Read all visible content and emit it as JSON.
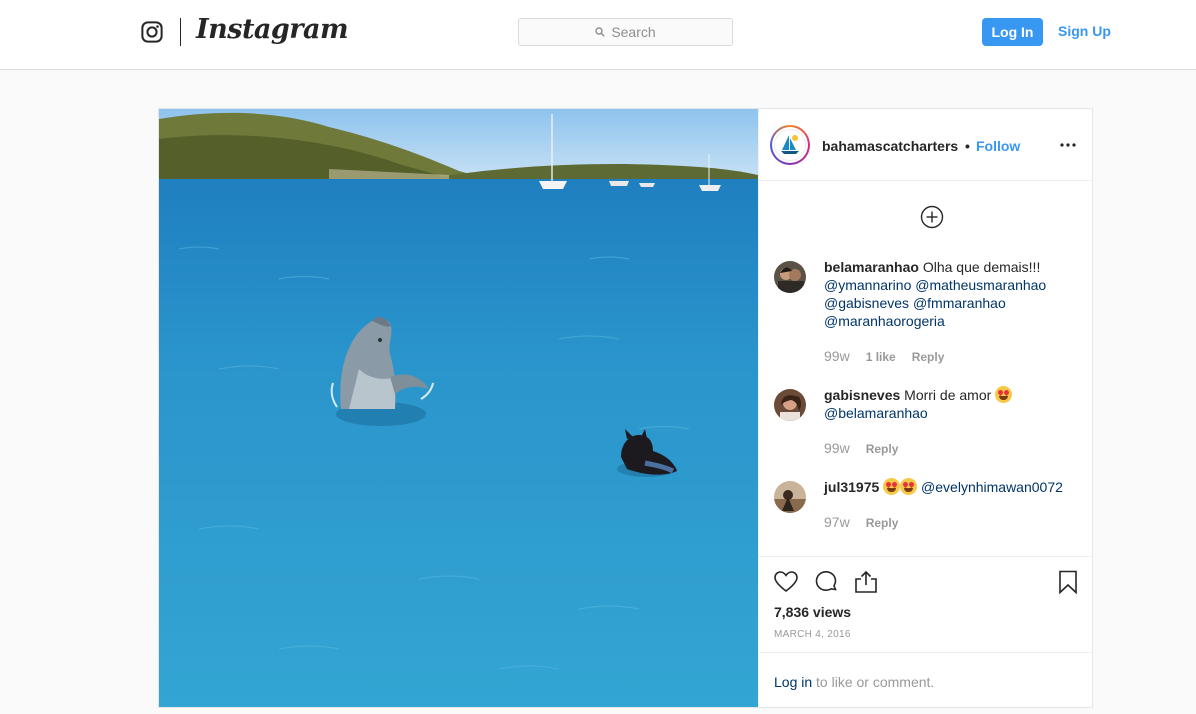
{
  "header": {
    "brand": "Instagram",
    "search_placeholder": "Search",
    "login_label": "Log In",
    "signup_label": "Sign Up"
  },
  "post": {
    "owner": "bahamascatcharters",
    "separator": "•",
    "follow_label": "Follow",
    "comments": [
      {
        "user": "belamaranhao",
        "text": "Olha que demais!!!",
        "mentions": [
          "@ymannarino",
          "@matheusmaranhao",
          "@gabisneves",
          "@fmmaranhao",
          "@maranhaorogeria"
        ],
        "time": "99w",
        "likes": "1 like",
        "reply": "Reply"
      },
      {
        "user": "gabisneves",
        "text": "Morri de amor",
        "mentions": [
          "@belamaranhao"
        ],
        "time": "99w",
        "reply": "Reply"
      },
      {
        "user": "jul31975",
        "mentions": [
          "@evelynhimawan0072"
        ],
        "time": "97w",
        "reply": "Reply"
      }
    ],
    "views": "7,836 views",
    "date": "MARCH 4, 2016",
    "login_prompt_link": "Log in",
    "login_prompt_text": "to like or comment."
  },
  "icons": {
    "camera": "instagram-camera-icon",
    "search": "search-icon",
    "more": "more-options-icon",
    "load_more": "load-more-comments-icon",
    "like": "heart-icon",
    "comment": "comment-icon",
    "share": "share-icon",
    "save": "bookmark-icon"
  },
  "colors": {
    "accent": "#3897f0",
    "mention": "#003569",
    "muted": "#999999",
    "border": "#dbdbdb"
  }
}
